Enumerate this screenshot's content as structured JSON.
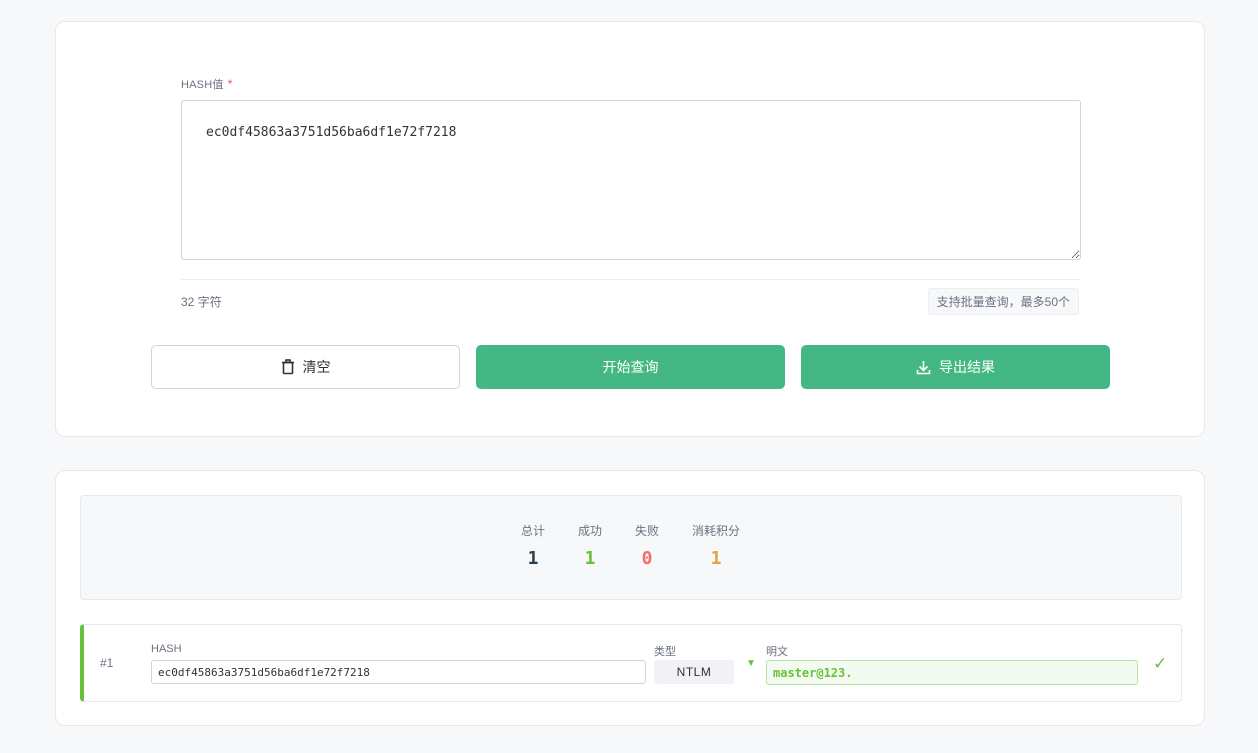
{
  "input": {
    "label": "HASH值",
    "required_mark": "*",
    "value": "ec0df45863a3751d56ba6df1e72f7218",
    "char_count": "32 字符",
    "batch_hint": "支持批量查询，最多50个"
  },
  "buttons": {
    "clear": "清空",
    "query": "开始查询",
    "export": "导出结果"
  },
  "stats": {
    "total": {
      "label": "总计",
      "value": "1",
      "color": "#2c3e50"
    },
    "success": {
      "label": "成功",
      "value": "1",
      "color": "#67c23a"
    },
    "fail": {
      "label": "失败",
      "value": "0",
      "color": "#f56c6c"
    },
    "points": {
      "label": "消耗积分",
      "value": "1",
      "color": "#e6a23c"
    }
  },
  "results": {
    "columns": {
      "hash": "HASH",
      "type": "类型",
      "plain": "明文"
    },
    "rows": [
      {
        "index": "#1",
        "hash": "ec0df45863a3751d56ba6df1e72f7218",
        "type": "NTLM",
        "plain": "master@123.",
        "status_icon": "check-icon"
      }
    ]
  },
  "colors": {
    "accent": "#43b884",
    "success": "#67c23a"
  }
}
